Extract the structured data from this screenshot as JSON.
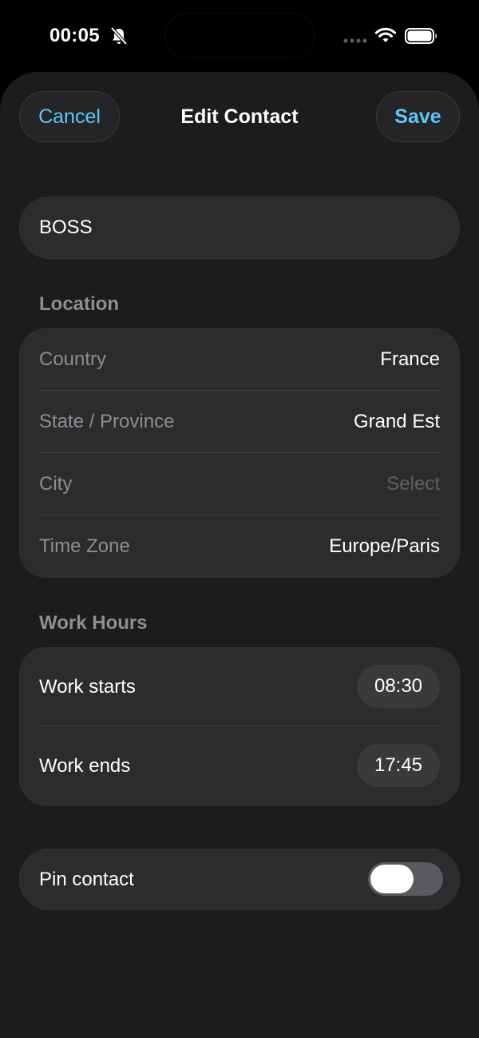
{
  "status_bar": {
    "time": "00:05",
    "icons": [
      "bell-slash-icon",
      "signal-icon",
      "wifi-icon",
      "battery-icon"
    ]
  },
  "nav": {
    "cancel_label": "Cancel",
    "title": "Edit Contact",
    "save_label": "Save"
  },
  "contact": {
    "name": "BOSS"
  },
  "location": {
    "header": "Location",
    "rows": [
      {
        "label": "Country",
        "value": "France"
      },
      {
        "label": "State / Province",
        "value": "Grand Est"
      },
      {
        "label": "City",
        "value": "Select"
      },
      {
        "label": "Time Zone",
        "value": "Europe/Paris"
      }
    ]
  },
  "work_hours": {
    "header": "Work Hours",
    "start_label": "Work starts",
    "start_time": "08:30",
    "end_label": "Work ends",
    "end_time": "17:45"
  },
  "pin": {
    "label": "Pin contact",
    "enabled": false
  },
  "colors": {
    "accent": "#5ac8fa",
    "background": "#1c1c1e",
    "card": "#2c2c2e",
    "secondary_text": "#8e8e93"
  }
}
